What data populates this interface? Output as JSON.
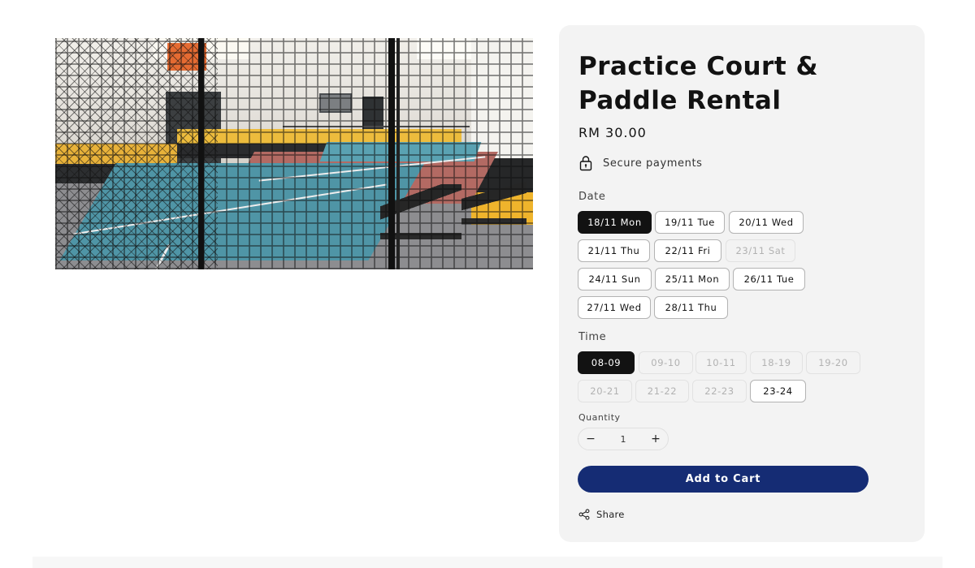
{
  "product": {
    "title": "Practice Court & Paddle Rental",
    "price": "RM 30.00",
    "secure_label": "Secure payments",
    "secure_icon": "lock-icon"
  },
  "date": {
    "label": "Date",
    "options": [
      {
        "label": "18/11 Mon",
        "state": "selected"
      },
      {
        "label": "19/11 Tue",
        "state": "available"
      },
      {
        "label": "20/11 Wed",
        "state": "available"
      },
      {
        "label": "21/11 Thu",
        "state": "available"
      },
      {
        "label": "22/11 Fri",
        "state": "available"
      },
      {
        "label": "23/11 Sat",
        "state": "disabled"
      },
      {
        "label": "24/11 Sun",
        "state": "available"
      },
      {
        "label": "25/11 Mon",
        "state": "available"
      },
      {
        "label": "26/11 Tue",
        "state": "available"
      },
      {
        "label": "27/11 Wed",
        "state": "available"
      },
      {
        "label": "28/11 Thu",
        "state": "available"
      }
    ]
  },
  "time": {
    "label": "Time",
    "options": [
      {
        "label": "08-09",
        "state": "selected"
      },
      {
        "label": "09-10",
        "state": "disabled"
      },
      {
        "label": "10-11",
        "state": "disabled"
      },
      {
        "label": "18-19",
        "state": "disabled"
      },
      {
        "label": "19-20",
        "state": "disabled"
      },
      {
        "label": "20-21",
        "state": "disabled"
      },
      {
        "label": "21-22",
        "state": "disabled"
      },
      {
        "label": "22-23",
        "state": "disabled"
      },
      {
        "label": "23-24",
        "state": "available"
      }
    ]
  },
  "quantity": {
    "label": "Quantity",
    "value": "1",
    "decrease": "−",
    "increase": "+"
  },
  "actions": {
    "add_to_cart": "Add to Cart",
    "share": "Share",
    "share_icon": "share-icon"
  },
  "colors": {
    "accent": "#152c74",
    "selected": "#121212",
    "panel_bg": "#f3f3f3"
  }
}
